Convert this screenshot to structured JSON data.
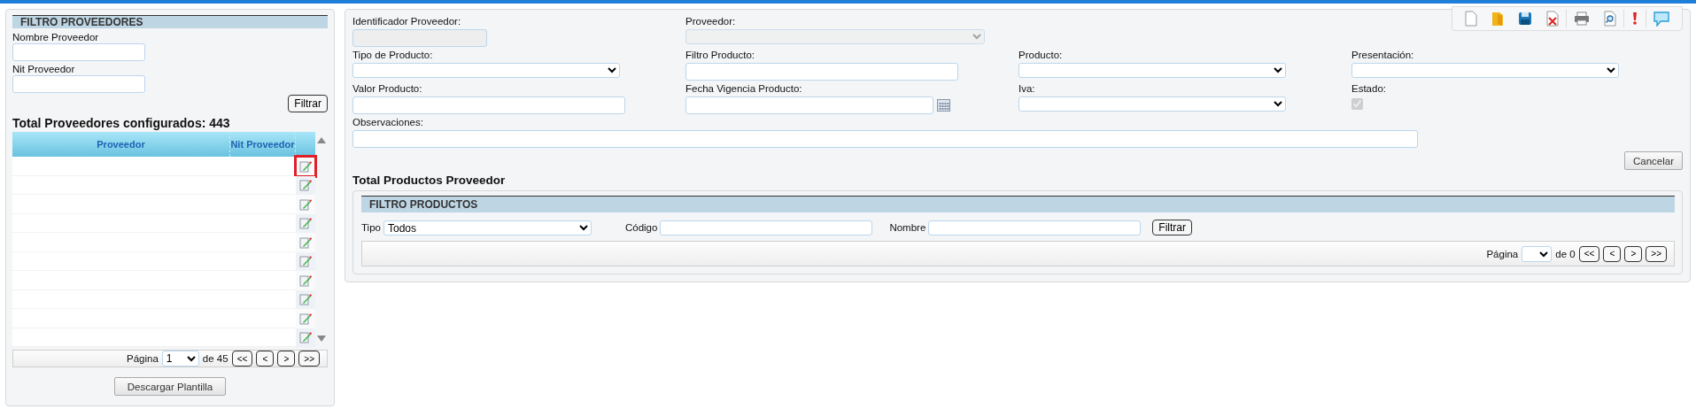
{
  "supplier_filter": {
    "title": "FILTRO PROVEEDORES",
    "fields": [
      {
        "label": "Nombre Proveedor"
      },
      {
        "label": "Nit Proveedor"
      }
    ],
    "filter_button": "Filtrar"
  },
  "supplier_total": "Total Proveedores configurados: 443",
  "supplier_table": {
    "columns": [
      "Proveedor",
      "Nit Proveedor"
    ],
    "rows": [
      {
        "highlighted": true
      },
      {
        "highlighted": false
      },
      {
        "highlighted": false
      },
      {
        "highlighted": false
      },
      {
        "highlighted": false
      },
      {
        "highlighted": false
      },
      {
        "highlighted": false
      },
      {
        "highlighted": false
      },
      {
        "highlighted": false
      },
      {
        "highlighted": false
      }
    ]
  },
  "supplier_pager": {
    "label": "Página",
    "page": "1",
    "of": "de 45",
    "buttons": [
      "<<",
      "<",
      ">",
      ">>"
    ]
  },
  "download_button": "Descargar Plantilla",
  "form": {
    "rows": [
      [
        {
          "label": "Identificador Proveedor:",
          "kind": "input",
          "disabled": true
        },
        {
          "label": "Proveedor:",
          "kind": "select",
          "disabled": true
        }
      ],
      [
        {
          "label": "Tipo de Producto:",
          "kind": "select",
          "disabled": false
        },
        {
          "label": "Filtro Producto:",
          "kind": "input",
          "disabled": false
        },
        {
          "label": "Producto:",
          "kind": "select",
          "disabled": false
        },
        {
          "label": "Presentación:",
          "kind": "select",
          "disabled": false
        }
      ],
      [
        {
          "label": "Valor Producto:",
          "kind": "input",
          "disabled": false
        },
        {
          "label": "Fecha Vigencia Producto:",
          "kind": "date",
          "disabled": false
        },
        {
          "label": "Iva:",
          "kind": "select",
          "disabled": false
        },
        {
          "label": "Estado:",
          "kind": "checkbox",
          "disabled": true,
          "checked": true
        }
      ],
      [
        {
          "label": "Observaciones:",
          "kind": "wide",
          "disabled": false
        }
      ]
    ],
    "cancel_button": "Cancelar"
  },
  "products_title": "Total Productos Proveedor",
  "product_filter": {
    "title": "FILTRO PRODUCTOS",
    "type_label": "Tipo",
    "type_value": "Todos",
    "code_label": "Código",
    "name_label": "Nombre",
    "filter_button": "Filtrar"
  },
  "products_pager": {
    "label": "Página",
    "of": "de 0",
    "buttons": [
      "<<",
      "<",
      ">",
      ">>"
    ]
  }
}
